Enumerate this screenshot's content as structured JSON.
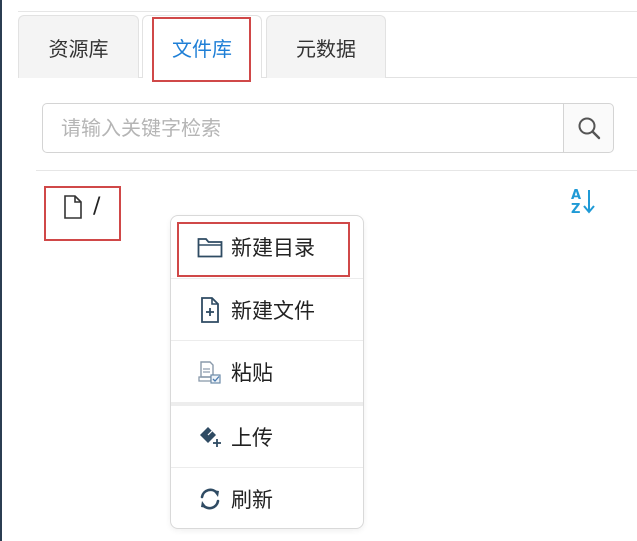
{
  "tabs": [
    {
      "label": "资源库",
      "active": false
    },
    {
      "label": "文件库",
      "active": true
    },
    {
      "label": "元数据",
      "active": false
    }
  ],
  "search": {
    "placeholder": "请输入关键字检索",
    "value": ""
  },
  "path": {
    "current": "/"
  },
  "context_menu": {
    "items": [
      {
        "label": "新建目录",
        "icon": "folder-icon"
      },
      {
        "label": "新建文件",
        "icon": "file-plus-icon"
      },
      {
        "label": "粘贴",
        "icon": "paste-icon"
      },
      {
        "label": "上传",
        "icon": "upload-icon"
      },
      {
        "label": "刷新",
        "icon": "refresh-icon"
      }
    ]
  },
  "colors": {
    "accent": "#1f7fd6",
    "highlight_border": "#d04848",
    "icon_dark": "#2f4b63"
  }
}
